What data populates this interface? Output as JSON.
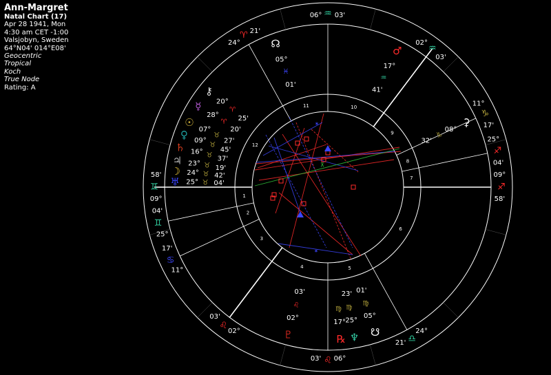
{
  "header": {
    "name": "Ann-Margret",
    "chart_label": "Natal Chart (17)",
    "date_line": "Apr 28 1941, Mon",
    "time_line": "4:30 am  CET -1:00",
    "place_line": "Valsjobyn, Sweden",
    "coords_line": "64°N04' 014°E08'",
    "settings": [
      "Geocentric",
      "Tropical",
      "Koch",
      "True Node"
    ],
    "rating": "Rating: A"
  },
  "colors": {
    "fire": "#ff2a2a",
    "earth": "#b2a23a",
    "air": "#32d2a2",
    "water": "#3c46ff",
    "saturn": "#e0e0e0",
    "mercury": "#b45ad2",
    "pluto": "#d2261e",
    "neptune": "#32c8a0"
  },
  "cusp_labels": [
    {
      "deg": "09°",
      "sign": "♊",
      "min": "58'",
      "color": "#32d2a2"
    },
    {
      "deg": "25°",
      "sign": "♊",
      "min": "04'",
      "color": "#32d2a2"
    },
    {
      "deg": "11°",
      "sign": "♋",
      "min": "17'",
      "color": "#3c46ff"
    },
    {
      "deg": "02°",
      "sign": "♌",
      "min": "03'",
      "color": "#ff2a2a"
    },
    {
      "deg": "06°",
      "sign": "♌",
      "min": "03'",
      "color": "#ff2a2a"
    },
    {
      "deg": "24°",
      "sign": "♎",
      "min": "21'",
      "color": "#32d2a2"
    },
    {
      "deg": "09°",
      "sign": "♐",
      "min": "58'",
      "color": "#ff2a2a"
    },
    {
      "deg": "25°",
      "sign": "♐",
      "min": "04'",
      "color": "#ff2a2a"
    },
    {
      "deg": "11°",
      "sign": "♑",
      "min": "17'",
      "color": "#b2a23a"
    },
    {
      "deg": "02°",
      "sign": "♒",
      "min": "03'",
      "color": "#32d2a2"
    },
    {
      "deg": "06°",
      "sign": "♒",
      "min": "03'",
      "color": "#32d2a2"
    },
    {
      "deg": "24°",
      "sign": "♈",
      "min": "21'",
      "color": "#ff2a2a"
    }
  ],
  "planets": [
    {
      "glyph": "♅",
      "deg": "25°",
      "sign": "♉",
      "min": "04'",
      "color": "#3c46ff",
      "sign_color": "#b2a23a"
    },
    {
      "glyph": "☽",
      "deg": "24°",
      "sign": "♉",
      "min": "42'",
      "color": "#e6c23a",
      "sign_color": "#b2a23a"
    },
    {
      "glyph": "♃",
      "deg": "23°",
      "sign": "♉",
      "min": "19'",
      "color": "#b4b4b4",
      "sign_color": "#b2a23a"
    },
    {
      "glyph": "♄",
      "deg": "16°",
      "sign": "♉",
      "min": "37'",
      "color": "#d23c1e",
      "sign_color": "#b2a23a"
    },
    {
      "glyph": "♀",
      "deg": "09°",
      "sign": "♉",
      "min": "45'",
      "color": "#1ea0a0",
      "sign_color": "#b2a23a"
    },
    {
      "glyph": "☉",
      "deg": "07°",
      "sign": "♉",
      "min": "27'",
      "color": "#d2b43c",
      "sign_color": "#b2a23a"
    },
    {
      "glyph": "☿",
      "deg": "28°",
      "sign": "♈",
      "min": "20'",
      "color": "#b45ad2",
      "sign_color": "#ff2a2a"
    },
    {
      "glyph": "⚷",
      "deg": "20°",
      "sign": "♈",
      "min": "25'",
      "color": "#e0e0e0",
      "sign_color": "#ff2a2a"
    },
    {
      "glyph": "☊",
      "deg": "05°",
      "sign": "♓",
      "min": "01'",
      "color": "#ffffff",
      "sign_color": "#3c46ff"
    },
    {
      "glyph": "♂",
      "deg": "17°",
      "sign": "♒",
      "min": "41'",
      "color": "#ff2a2a",
      "sign_color": "#32d2a2"
    },
    {
      "glyph": "⚳",
      "deg": "08°",
      "sign": "♑",
      "min": "32'",
      "color": "#ffffff",
      "sign_color": "#b2a23a"
    },
    {
      "glyph": "♇",
      "deg": "02°",
      "sign": "♌",
      "min": "03'",
      "color": "#d2261e",
      "sign_color": "#ff2a2a"
    },
    {
      "glyph": "☋",
      "deg": "05°",
      "sign": "♍",
      "min": "01'",
      "color": "#ffffff",
      "sign_color": "#b2a23a"
    },
    {
      "glyph": "♆",
      "deg": "25°",
      "sign": "♍",
      "min": "23'",
      "color": "#32c8a0",
      "sign_color": "#b2a23a"
    },
    {
      "glyph": "℞",
      "deg": "17°",
      "sign": "♍",
      "min": "",
      "color": "#ff2a2a",
      "sign_color": "#b2a23a"
    }
  ],
  "inner_marks": [
    {
      "kind": "square",
      "color": "#ff2a2a"
    },
    {
      "kind": "square",
      "color": "#ff2a2a"
    },
    {
      "kind": "square",
      "color": "#ff2a2a"
    },
    {
      "kind": "square",
      "color": "#ff2a2a"
    },
    {
      "kind": "square",
      "color": "#ff2a2a"
    },
    {
      "kind": "square",
      "color": "#ff2a2a"
    },
    {
      "kind": "square",
      "color": "#ff2a2a"
    },
    {
      "kind": "square",
      "color": "#ff2a2a"
    },
    {
      "kind": "square",
      "color": "#ff2a2a"
    },
    {
      "kind": "trine",
      "color": "#3c46ff"
    },
    {
      "kind": "trine",
      "color": "#3c46ff"
    },
    {
      "kind": "sextile",
      "color": "#3c46ff"
    },
    {
      "kind": "sextile",
      "color": "#3c46ff"
    },
    {
      "kind": "quincunx",
      "color": "#32c83c"
    }
  ],
  "house_numbers": [
    "1",
    "2",
    "3",
    "4",
    "5",
    "6",
    "7",
    "8",
    "9",
    "10",
    "11",
    "12"
  ]
}
